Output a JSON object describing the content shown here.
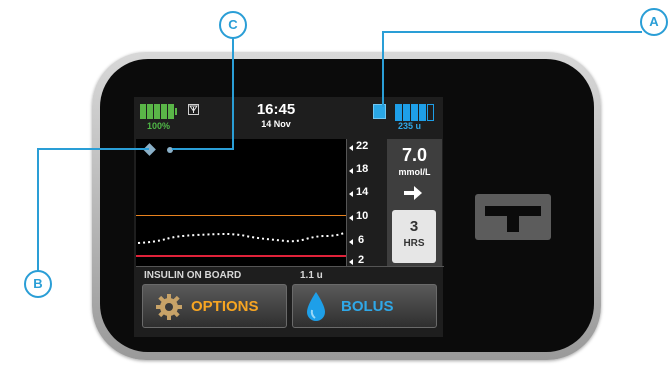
{
  "status": {
    "battery_percent": "100%",
    "time": "16:45",
    "date": "14 Nov",
    "insulin_units": "235 u"
  },
  "graph": {
    "y_ticks": [
      "22",
      "18",
      "14",
      "10",
      "6",
      "2"
    ],
    "high_line_color": "#e8821e",
    "low_line_color": "#e0223a",
    "trace_color": "#ffffff"
  },
  "glucose": {
    "value": "7.0",
    "unit": "mmol/L",
    "trend": "arrow-right-icon",
    "period_value": "3",
    "period_unit": "HRS"
  },
  "iob": {
    "label": "INSULIN ON BOARD",
    "value": "1.1 u"
  },
  "buttons": {
    "options": "OPTIONS",
    "bolus": "BOLUS",
    "options_color": "#f7a522",
    "bolus_color": "#2fa8e8"
  },
  "callouts": {
    "a": "A",
    "b": "B",
    "c": "C",
    "color": "#2a9ed6"
  }
}
